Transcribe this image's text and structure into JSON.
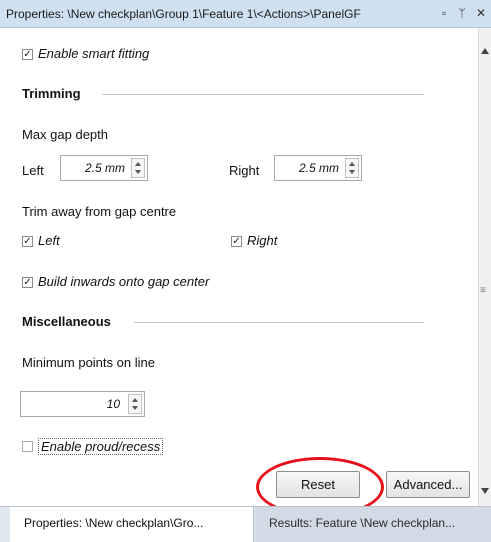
{
  "window": {
    "title": "Properties: \\New checkplan\\Group 1\\Feature 1\\<Actions>\\PanelGF",
    "icons": [
      "restore-window-icon",
      "pin-icon",
      "close-icon"
    ]
  },
  "panel": {
    "enable_smart_fitting": {
      "label": "Enable smart fitting",
      "checked": true
    },
    "trimming": {
      "header": "Trimming",
      "max_gap_depth_label": "Max gap depth",
      "left_label": "Left",
      "left_value": "2.5 mm",
      "right_label": "Right",
      "right_value": "2.5 mm",
      "trim_away_label": "Trim away from gap centre",
      "trim_left": {
        "label": "Left",
        "checked": true
      },
      "trim_right": {
        "label": "Right",
        "checked": true
      },
      "build_inwards": {
        "label": "Build inwards onto gap center",
        "checked": true
      }
    },
    "misc": {
      "header": "Miscellaneous",
      "min_points_label": "Minimum points on line",
      "min_points_value": "10",
      "enable_proud": {
        "label": "Enable proud/recess",
        "checked": false
      }
    },
    "buttons": {
      "reset": "Reset",
      "advanced": "Advanced..."
    }
  },
  "tabs": [
    {
      "label": "Properties: \\New checkplan\\Gro...",
      "active": true
    },
    {
      "label": "Results: Feature \\New checkplan...",
      "active": false
    }
  ],
  "colors": {
    "highlight_ring": "#e8101a",
    "titlebar": "#cfe0f1"
  }
}
